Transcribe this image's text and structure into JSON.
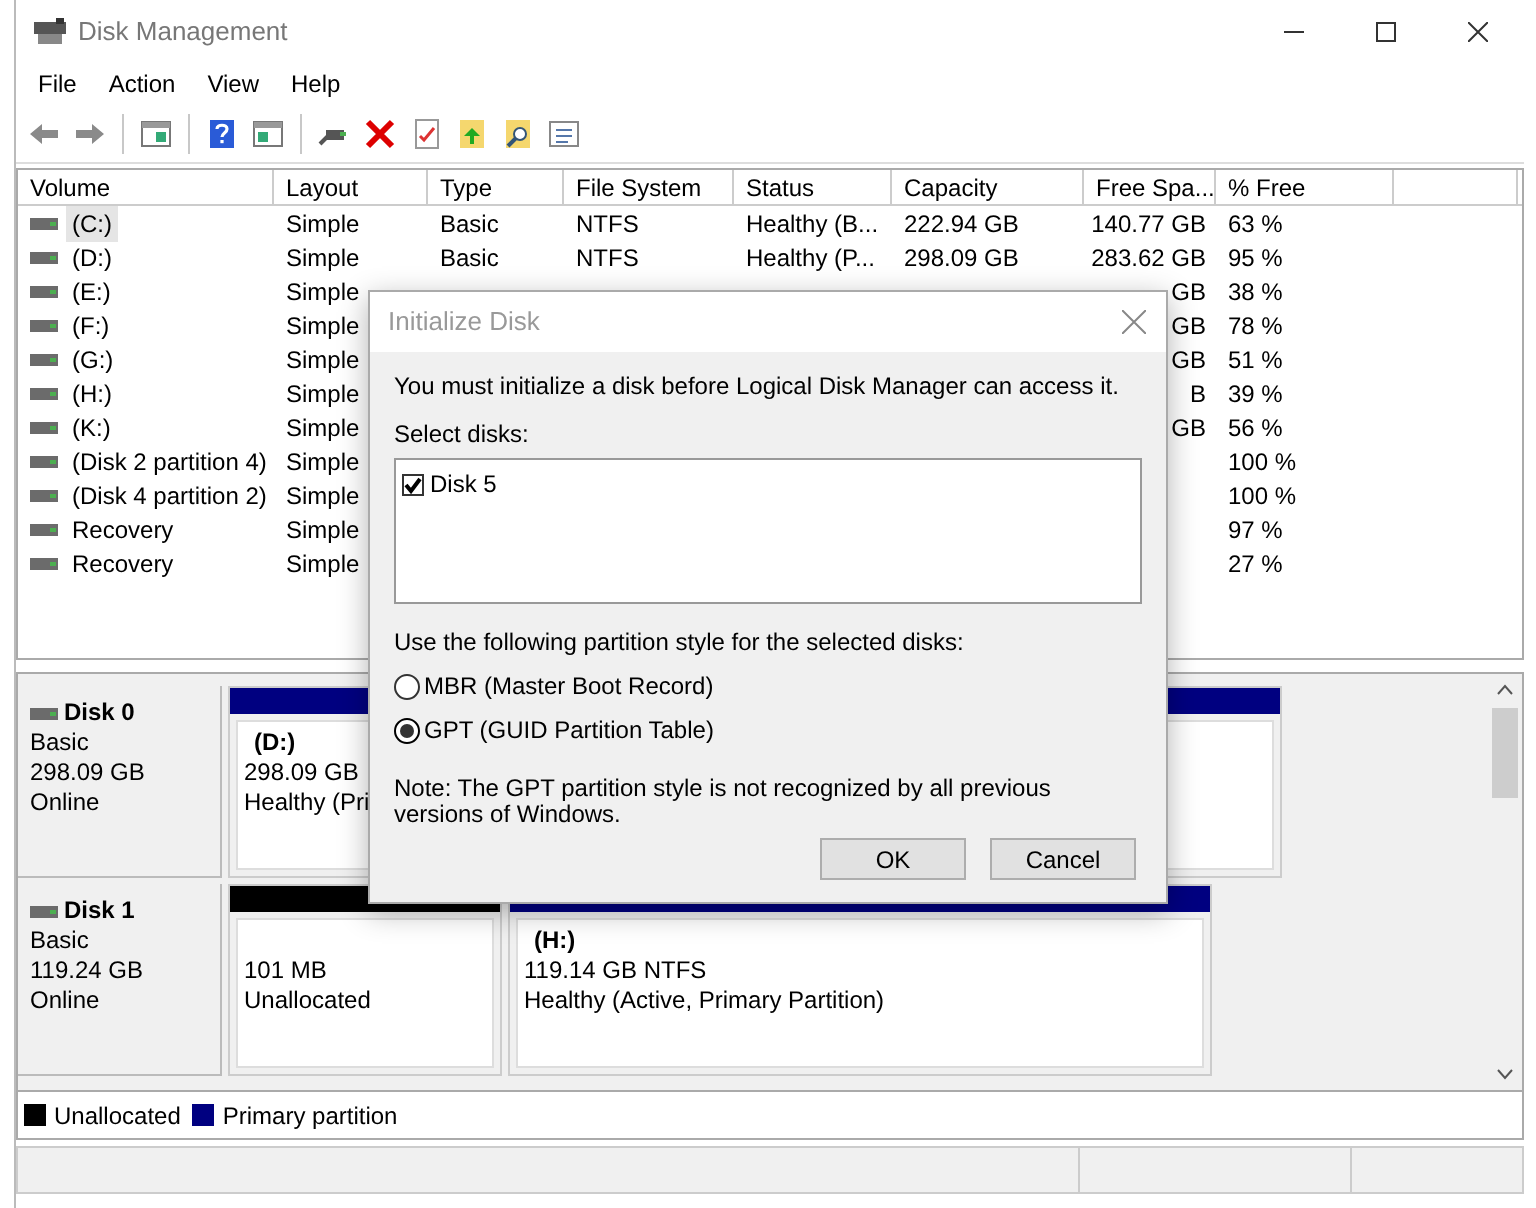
{
  "window": {
    "title": "Disk Management"
  },
  "menu": [
    "File",
    "Action",
    "View",
    "Help"
  ],
  "volumes": {
    "columns": [
      "Volume",
      "Layout",
      "Type",
      "File System",
      "Status",
      "Capacity",
      "Free Spa...",
      "% Free"
    ],
    "rows": [
      {
        "volume": "(C:)",
        "layout": "Simple",
        "type": "Basic",
        "file_system": "NTFS",
        "status": "Healthy (B...",
        "capacity": "222.94 GB",
        "free_space": "140.77 GB",
        "percent_free": "63 %",
        "selected": true
      },
      {
        "volume": "(D:)",
        "layout": "Simple",
        "type": "Basic",
        "file_system": "NTFS",
        "status": "Healthy (P...",
        "capacity": "298.09 GB",
        "free_space": "283.62 GB",
        "percent_free": "95 %",
        "selected": false
      },
      {
        "volume": "(E:)",
        "layout": "Simple",
        "free_space": "GB",
        "percent_free": "38 %",
        "selected": false
      },
      {
        "volume": "(F:)",
        "layout": "Simple",
        "free_space": "GB",
        "percent_free": "78 %",
        "selected": false
      },
      {
        "volume": "(G:)",
        "layout": "Simple",
        "free_space": "GB",
        "percent_free": "51 %",
        "selected": false
      },
      {
        "volume": "(H:)",
        "layout": "Simple",
        "free_space": "B",
        "percent_free": "39 %",
        "selected": false
      },
      {
        "volume": "(K:)",
        "layout": "Simple",
        "free_space": "GB",
        "percent_free": "56 %",
        "selected": false
      },
      {
        "volume": "(Disk 2 partition 4)",
        "layout": "Simple",
        "percent_free": "100 %",
        "selected": false
      },
      {
        "volume": "(Disk 4 partition 2)",
        "layout": "Simple",
        "percent_free": "100 %",
        "selected": false
      },
      {
        "volume": "Recovery",
        "layout": "Simple",
        "percent_free": "97 %",
        "selected": false
      },
      {
        "volume": "Recovery",
        "layout": "Simple",
        "percent_free": "27 %",
        "selected": false
      }
    ]
  },
  "disks": [
    {
      "name": "Disk 0",
      "type": "Basic",
      "size": "298.09 GB",
      "state": "Online",
      "partitions": [
        {
          "kind": "primary",
          "label": "(D:)",
          "size": "298.09 GB",
          "status": "Healthy (Pri"
        }
      ]
    },
    {
      "name": "Disk 1",
      "type": "Basic",
      "size": "119.24 GB",
      "state": "Online",
      "partitions": [
        {
          "kind": "unallocated",
          "size": "101 MB",
          "status": "Unallocated"
        },
        {
          "kind": "primary",
          "label": "(H:)",
          "size": "119.14 GB NTFS",
          "status": "Healthy (Active, Primary Partition)"
        }
      ]
    }
  ],
  "legend": [
    {
      "label": "Unallocated",
      "color": "#000000"
    },
    {
      "label": "Primary partition",
      "color": "#000080"
    }
  ],
  "dialog": {
    "title": "Initialize Disk",
    "message": "You must initialize a disk before Logical Disk Manager can access it.",
    "select_label": "Select disks:",
    "disks": [
      {
        "label": "Disk 5",
        "checked": true
      }
    ],
    "style_label": "Use the following partition style for the selected disks:",
    "options": [
      {
        "label": "MBR (Master Boot Record)",
        "selected": false
      },
      {
        "label": "GPT (GUID Partition Table)",
        "selected": true
      }
    ],
    "note": "Note: The GPT partition style is not recognized by all previous versions of Windows.",
    "buttons": [
      "OK",
      "Cancel"
    ]
  }
}
